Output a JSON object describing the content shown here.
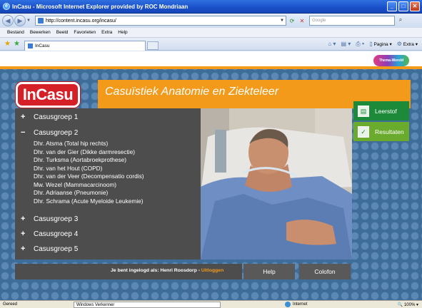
{
  "window": {
    "title": "InCasu - Microsoft Internet Explorer provided by ROC Mondriaan"
  },
  "address": {
    "url": "http://content.incasu.org/incasu/",
    "search_placeholder": "Google"
  },
  "menu": [
    "Bestand",
    "Bewerken",
    "Beeld",
    "Favorieten",
    "Extra",
    "Help"
  ],
  "tab": {
    "label": "InCasu"
  },
  "commandbar": {
    "page_label": "Pagina",
    "tools_label": "Extra"
  },
  "page": {
    "thema_logo": "Thema-Wereld",
    "logo_text": "InCasu",
    "banner_title": "Casuïstiek Anatomie en Ziekteleer",
    "groups": [
      {
        "symbol": "+",
        "label": "Casusgroep 1"
      },
      {
        "symbol": "−",
        "label": "Casusgroep 2"
      },
      {
        "symbol": "+",
        "label": "Casusgroep 3"
      },
      {
        "symbol": "+",
        "label": "Casusgroep 4"
      },
      {
        "symbol": "+",
        "label": "Casusgroep 5"
      }
    ],
    "patients": [
      "Dhr. Atsma (Total hip rechts)",
      "Dhr. van der Gier (Dikke darmresectie)",
      "Dhr. Turksma (Aortabroekprothese)",
      "Dhr. van het Hout (COPD)",
      "Dhr. van der Veer (Decompensatio cordis)",
      "Mw. Wezel (Mammacarcinoom)",
      "Dhr. Adriaanse (Pneumonie)",
      "Dhr. Schrama (Acute Myeloide Leukemie)"
    ],
    "side_buttons": {
      "leerstof": "Leerstof",
      "resultaten": "Resultaten"
    },
    "login": {
      "prefix": "Je bent ingelogd als: Henri Roosdorp - ",
      "logout": "Uitloggen"
    },
    "bottom_buttons": {
      "help": "Help",
      "colofon": "Colofon"
    }
  },
  "statusbar": {
    "left": "Gereed",
    "middle": "Windows Verkenner",
    "zone": "Internet",
    "zoom": "100%"
  },
  "colors": {
    "accent_orange": "#f39a1a",
    "green": "#1d8a3a",
    "logo_red": "#d62027",
    "panel_gray": "#4d4d4d"
  }
}
